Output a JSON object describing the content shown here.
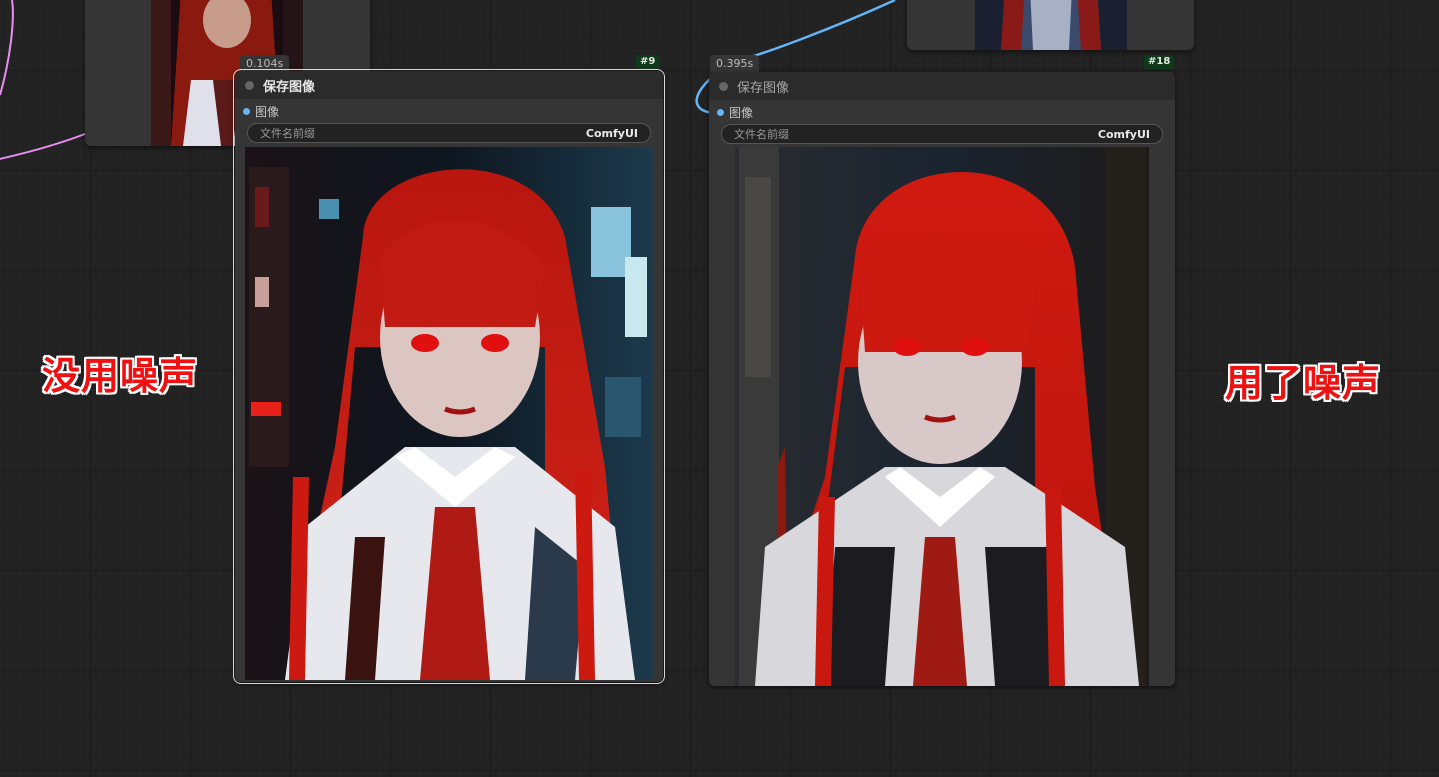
{
  "node_left": {
    "timing": "0.104s",
    "id_badge": "#9",
    "title": "保存图像",
    "input_label": "图像",
    "widget_label": "文件名前缀",
    "widget_value": "ComfyUI"
  },
  "node_right": {
    "timing": "0.395s",
    "id_badge": "#18",
    "title": "保存图像",
    "input_label": "图像",
    "widget_label": "文件名前缀",
    "widget_value": "ComfyUI"
  },
  "captions": {
    "left": "没用噪声",
    "right": "用了噪声"
  },
  "colors": {
    "wire_image": "#64b5f6",
    "wire_latent": "#e88ef0",
    "caption_red": "#ee1111",
    "badge_green": "#0f3a1a"
  }
}
